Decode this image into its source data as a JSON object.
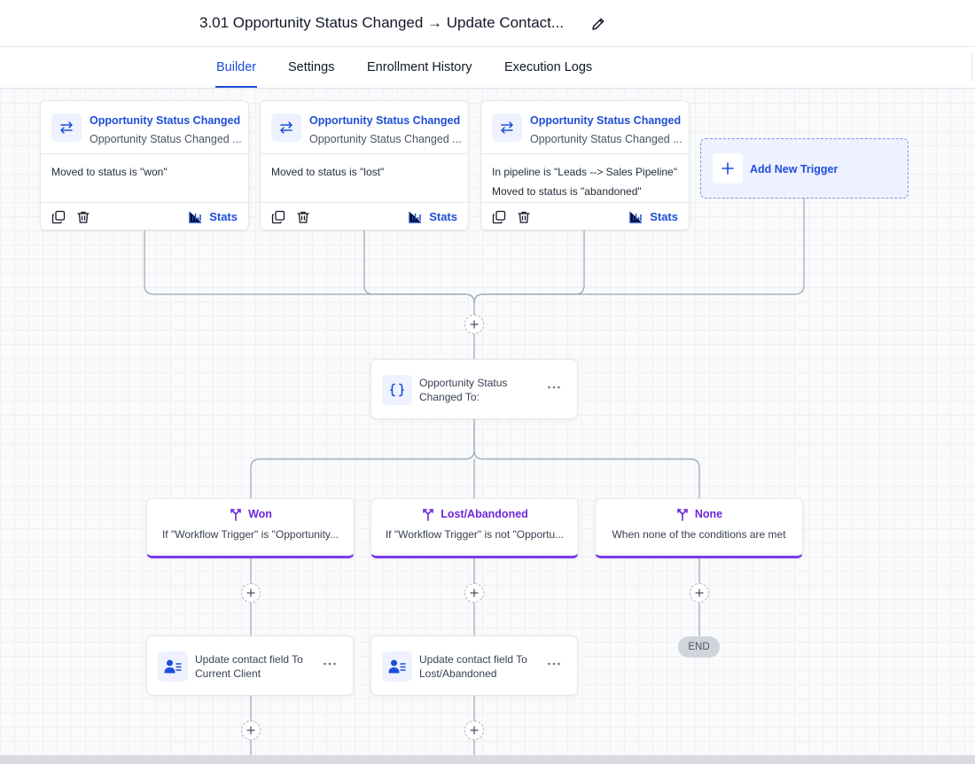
{
  "header": {
    "title": "3.01 Opportunity Status Changed → Update Contact...",
    "edit_icon": "pencil-icon"
  },
  "tabs": [
    {
      "label": "Builder",
      "active": true
    },
    {
      "label": "Settings",
      "active": false
    },
    {
      "label": "Enrollment History",
      "active": false
    },
    {
      "label": "Execution Logs",
      "active": false
    }
  ],
  "triggers": [
    {
      "name": "Opportunity Status Changed",
      "subtitle": "Opportunity Status Changed ...",
      "conditions": [
        "Moved to status is \"won\""
      ],
      "stats_label": "Stats"
    },
    {
      "name": "Opportunity Status Changed",
      "subtitle": "Opportunity Status Changed ...",
      "conditions": [
        "Moved to status is \"lost\""
      ],
      "stats_label": "Stats"
    },
    {
      "name": "Opportunity Status Changed",
      "subtitle": "Opportunity Status Changed ...",
      "conditions": [
        "In pipeline is \"Leads --> Sales Pipeline\"",
        "Moved to status is \"abandoned\""
      ],
      "stats_label": "Stats"
    }
  ],
  "add_trigger": {
    "label": "Add New Trigger"
  },
  "condition_node": {
    "label_line1": "Opportunity Status",
    "label_line2": "Changed To:",
    "icon": "curly-braces-icon"
  },
  "branches": [
    {
      "name": "Won",
      "description": "If \"Workflow Trigger\" is \"Opportunity..."
    },
    {
      "name": "Lost/Abandoned",
      "description": "If \"Workflow Trigger\" is not \"Opportu..."
    },
    {
      "name": "None",
      "description": "When none of the conditions are met"
    }
  ],
  "actions": [
    {
      "line1": "Update contact field To",
      "line2": "Current Client",
      "icon": "contact-update-icon"
    },
    {
      "line1": "Update contact field To",
      "line2": "Lost/Abandoned",
      "icon": "contact-update-icon"
    }
  ],
  "end_label": "END",
  "colors": {
    "accent": "#1d4ed8",
    "branch": "#7c3aed",
    "canvas": "#f9fafb"
  }
}
